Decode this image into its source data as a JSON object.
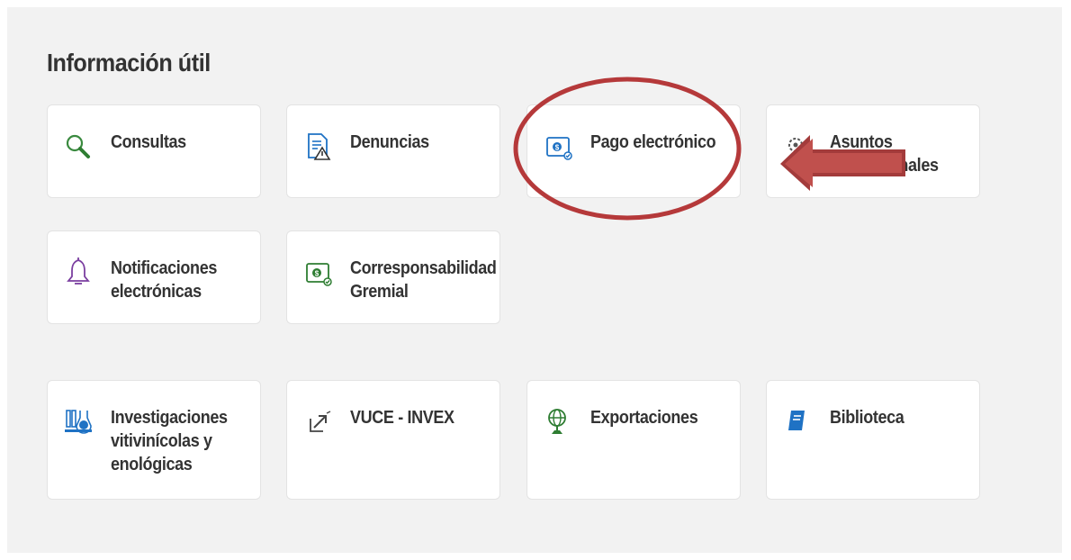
{
  "section": {
    "title": "Información útil"
  },
  "cards": [
    {
      "label": "Consultas",
      "icon": "magnifier-icon"
    },
    {
      "label": "Denuncias",
      "icon": "document-warning-icon"
    },
    {
      "label": "Pago electrónico",
      "icon": "payment-icon"
    },
    {
      "label": "Asuntos Institucionales",
      "icon": "gears-icon"
    },
    {
      "label": "Notificaciones electrónicas",
      "icon": "bell-icon"
    },
    {
      "label": "Corresponsabilidad Gremial",
      "icon": "payment-check-icon"
    },
    {
      "label": "Investigaciones vitivinícolas y enológicas",
      "icon": "lab-flasks-icon"
    },
    {
      "label": "VUCE - INVEX",
      "icon": "export-arrow-icon"
    },
    {
      "label": "Exportaciones",
      "icon": "globe-icon"
    },
    {
      "label": "Biblioteca",
      "icon": "book-icon"
    }
  ],
  "colors": {
    "background_panel": "#f2f2f2",
    "card": "#ffffff",
    "text": "#333333",
    "annotation_red": "#b5393a",
    "green": "#2e7d32",
    "blue": "#1f72c4",
    "purple": "#7b3fa0"
  }
}
